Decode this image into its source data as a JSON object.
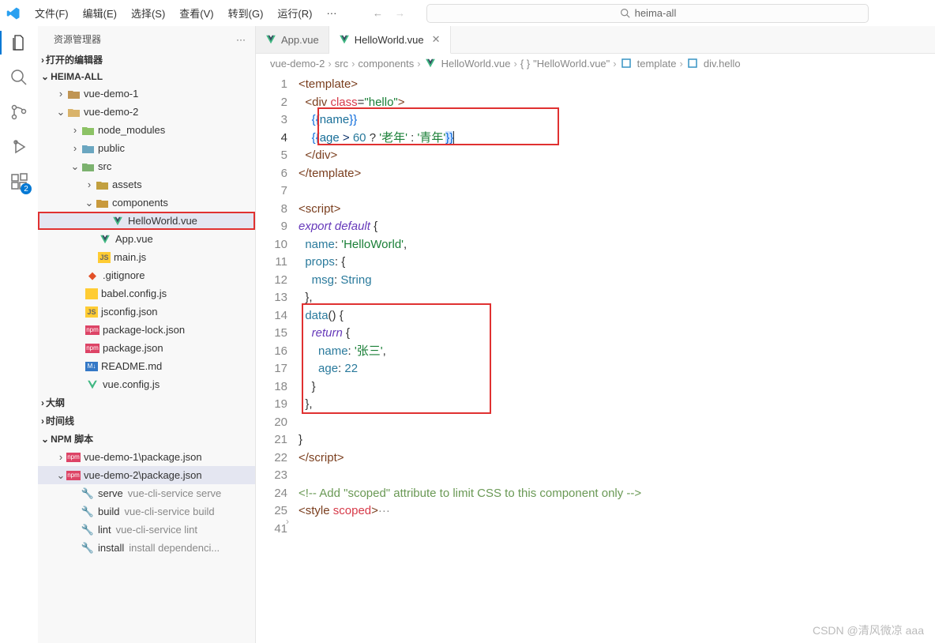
{
  "menu": {
    "file": "文件(F)",
    "edit": "编辑(E)",
    "select": "选择(S)",
    "view": "查看(V)",
    "goto": "转到(G)",
    "run": "运行(R)",
    "more": "···"
  },
  "search": {
    "placeholder": "heima-all"
  },
  "sidebar": {
    "title": "资源管理器",
    "more": "···",
    "opened": "打开的编辑器",
    "root": "HEIMA-ALL",
    "tree": {
      "vuedemo1": "vue-demo-1",
      "vuedemo2": "vue-demo-2",
      "node_modules": "node_modules",
      "public": "public",
      "src": "src",
      "assets": "assets",
      "components": "components",
      "helloworld": "HelloWorld.vue",
      "appvue": "App.vue",
      "mainjs": "main.js",
      "gitignore": ".gitignore",
      "babel": "babel.config.js",
      "jsconfig": "jsconfig.json",
      "pkglock": "package-lock.json",
      "pkg": "package.json",
      "readme": "README.md",
      "vueconfig": "vue.config.js"
    },
    "outline": "大纲",
    "timeline": "时间线",
    "npm": "NPM 脚本",
    "npm_items": {
      "p1": "vue-demo-1\\package.json",
      "p2": "vue-demo-2\\package.json",
      "serve": "serve",
      "serve_cmd": "vue-cli-service serve",
      "build": "build",
      "build_cmd": "vue-cli-service build",
      "lint": "lint",
      "lint_cmd": "vue-cli-service lint",
      "install": "install",
      "install_cmd": "install dependenci..."
    }
  },
  "activity": {
    "badge": "2"
  },
  "tabs": {
    "app": "App.vue",
    "hello": "HelloWorld.vue"
  },
  "breadcrumb": {
    "p1": "vue-demo-2",
    "p2": "src",
    "p3": "components",
    "p4": "HelloWorld.vue",
    "p5": "\"HelloWorld.vue\"",
    "p6": "template",
    "p7": "div.hello"
  },
  "code": {
    "l1": "<template>",
    "l2": "  <div class=\"hello\">",
    "l3": "    {{name}}",
    "l4a": "    {{age > 60 ? ",
    "l4b": "'老年'",
    "l4c": " : ",
    "l4d": "'青年'",
    "l4e": "}}",
    "l5": "  </div>",
    "l6": "</template>",
    "l8": "<script>",
    "l9": "export default {",
    "l10": "  name: 'HelloWorld',",
    "l11": "  props: {",
    "l12": "    msg: String",
    "l13": "  },",
    "l14": "  data() {",
    "l15": "    return {",
    "l16": "      name: '张三',",
    "l17": "      age: 22",
    "l18": "    }",
    "l19": "  },",
    "l21": "}",
    "l22_open": "</scr",
    "l22_close": "ipt>",
    "l24": "<!-- Add \"scoped\" attribute to limit CSS to this component only -->",
    "l25": "<style scoped>",
    "l25_fold": "···"
  },
  "lines": [
    "1",
    "2",
    "3",
    "4",
    "5",
    "6",
    "7",
    "8",
    "9",
    "10",
    "11",
    "12",
    "13",
    "14",
    "15",
    "16",
    "17",
    "18",
    "19",
    "20",
    "21",
    "22",
    "23",
    "24",
    "25",
    "41"
  ],
  "watermark": "CSDN @清风微凉 aaa"
}
